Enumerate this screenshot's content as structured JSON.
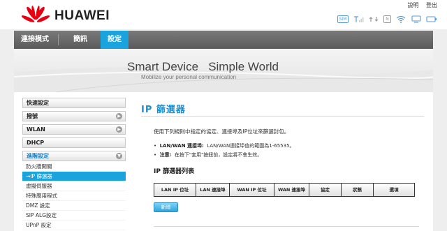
{
  "header": {
    "brand": "HUAWEI",
    "links": {
      "help": "說明",
      "logout": "登出"
    },
    "status_icons": [
      "sim-icon",
      "signal-icon",
      "network-icon",
      "n-icon",
      "wifi-icon",
      "computer-icon",
      "battery-icon"
    ]
  },
  "nav": {
    "items": [
      {
        "label": "連接模式",
        "active": false
      },
      {
        "label": "簡訊",
        "active": false
      },
      {
        "label": "設定",
        "active": true
      }
    ]
  },
  "banner": {
    "title": "Smart Device   Simple World",
    "subtitle": "Mobilize your personal communication"
  },
  "sidebar": {
    "sections": [
      {
        "label": "快速設定",
        "has_arrow": false
      },
      {
        "label": "撥號",
        "has_arrow": true
      },
      {
        "label": "WLAN",
        "has_arrow": true
      },
      {
        "label": "DHCP",
        "has_arrow": false
      },
      {
        "label": "進階設定",
        "has_arrow": true
      }
    ],
    "sub_items": [
      "防火牆開關",
      "→IP 篩選器",
      "虛擬伺服器",
      "特殊應用程式",
      "DMZ 設定",
      "SIP ALG設定",
      "UPnP 設定"
    ]
  },
  "content": {
    "title": "IP 篩選器",
    "description": "使用下列規則中指定的協定、連接埠及IP位址來篩選封包。",
    "bullet1_label": "LAN/WAN 連接埠:",
    "bullet1_text": "LAN/WAN連接埠值的範圍為1-65535。",
    "bullet2_label": "注意:",
    "bullet2_text": "在按下\"套用\"按鈕前，設定將不會生效。",
    "list_title": "IP 篩選器列表",
    "columns": [
      "LAN IP 位址",
      "LAN 連接埠",
      "WAN IP 位址",
      "WAN 連接埠",
      "協定",
      "狀態",
      "選項"
    ],
    "add_button": "新增"
  },
  "colors": {
    "accent": "#1aa3dc",
    "brand_red": "#e60012",
    "nav_bg": "#666666"
  }
}
